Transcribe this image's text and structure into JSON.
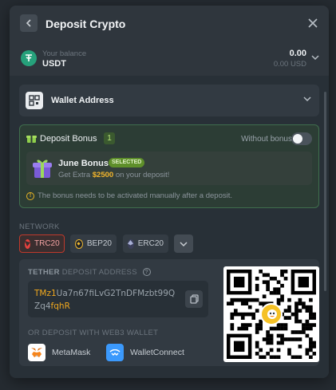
{
  "modal": {
    "title": "Deposit Crypto"
  },
  "balance": {
    "label": "Your balance",
    "currency": "USDT",
    "amount": "0.00",
    "usd": "0.00 USD"
  },
  "wallet": {
    "label": "Wallet Address"
  },
  "bonus": {
    "title": "Deposit Bonus",
    "count": "1",
    "without_label": "Without bonus",
    "toggle_on": false,
    "card": {
      "title": "June Bonus",
      "badge": "SELECTED",
      "desc_prefix": "Get Extra ",
      "amount": "$2500",
      "desc_suffix": " on your deposit!"
    },
    "note": "The bonus needs to be activated manually after a deposit."
  },
  "network": {
    "label": "NETWORK",
    "options": [
      {
        "label": "TRC20",
        "active": true,
        "color": "#e8413e"
      },
      {
        "label": "BEP20",
        "active": false,
        "color": "#f3ba2f"
      },
      {
        "label": "ERC20",
        "active": false,
        "color": "#8a92b2"
      }
    ]
  },
  "deposit": {
    "label_strong": "TETHER",
    "label_rest": " DEPOSIT ADDRESS",
    "address_head": "TMz1",
    "address_mid": "Ua7n67fiLvG2TnDFMzbt99QZq4",
    "address_tail": "fqhR",
    "web3_label": "OR DEPOSIT WITH WEB3 WALLET",
    "wallets": [
      {
        "label": "MetaMask",
        "icon": "metamask-icon"
      },
      {
        "label": "WalletConnect",
        "icon": "walletconnect-icon"
      }
    ]
  },
  "colors": {
    "accent_green": "#5e8f2a",
    "highlight_orange": "#f0a81e",
    "tether_green": "#26a17b"
  }
}
